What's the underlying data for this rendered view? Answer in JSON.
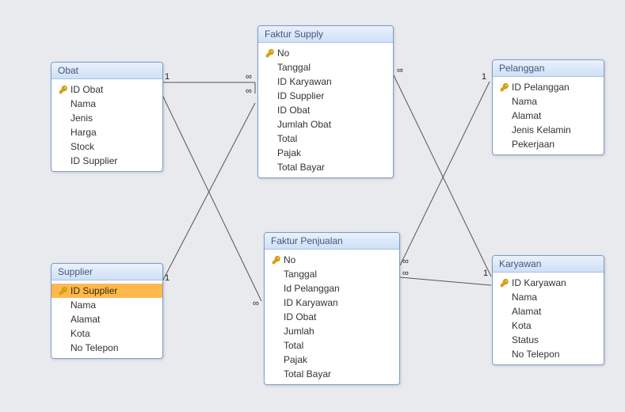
{
  "entities": {
    "obat": {
      "title": "Obat",
      "fields": [
        {
          "label": "ID Obat",
          "pk": true
        },
        {
          "label": "Nama",
          "pk": false
        },
        {
          "label": "Jenis",
          "pk": false
        },
        {
          "label": "Harga",
          "pk": false
        },
        {
          "label": "Stock",
          "pk": false
        },
        {
          "label": "ID Supplier",
          "pk": false
        }
      ]
    },
    "faktur_supply": {
      "title": "Faktur Supply",
      "fields": [
        {
          "label": "No",
          "pk": true
        },
        {
          "label": "Tanggal",
          "pk": false
        },
        {
          "label": "ID Karyawan",
          "pk": false
        },
        {
          "label": "ID Supplier",
          "pk": false
        },
        {
          "label": "ID Obat",
          "pk": false
        },
        {
          "label": "Jumlah Obat",
          "pk": false
        },
        {
          "label": "Total",
          "pk": false
        },
        {
          "label": "Pajak",
          "pk": false
        },
        {
          "label": "Total Bayar",
          "pk": false
        }
      ]
    },
    "pelanggan": {
      "title": "Pelanggan",
      "fields": [
        {
          "label": "ID Pelanggan",
          "pk": true
        },
        {
          "label": "Nama",
          "pk": false
        },
        {
          "label": "Alamat",
          "pk": false
        },
        {
          "label": "Jenis Kelamin",
          "pk": false
        },
        {
          "label": "Pekerjaan",
          "pk": false
        }
      ]
    },
    "supplier": {
      "title": "Supplier",
      "selectedField": "ID Supplier",
      "fields": [
        {
          "label": "ID Supplier",
          "pk": true
        },
        {
          "label": "Nama",
          "pk": false
        },
        {
          "label": "Alamat",
          "pk": false
        },
        {
          "label": "Kota",
          "pk": false
        },
        {
          "label": "No Telepon",
          "pk": false
        }
      ]
    },
    "faktur_penjualan": {
      "title": "Faktur Penjualan",
      "fields": [
        {
          "label": "No",
          "pk": true
        },
        {
          "label": "Tanggal",
          "pk": false
        },
        {
          "label": "Id Pelanggan",
          "pk": false
        },
        {
          "label": "ID Karyawan",
          "pk": false
        },
        {
          "label": "ID Obat",
          "pk": false
        },
        {
          "label": "Jumlah",
          "pk": false
        },
        {
          "label": "Total",
          "pk": false
        },
        {
          "label": "Pajak",
          "pk": false
        },
        {
          "label": "Total Bayar",
          "pk": false
        }
      ]
    },
    "karyawan": {
      "title": "Karyawan",
      "fields": [
        {
          "label": "ID Karyawan",
          "pk": true
        },
        {
          "label": "Nama",
          "pk": false
        },
        {
          "label": "Alamat",
          "pk": false
        },
        {
          "label": "Kota",
          "pk": false
        },
        {
          "label": "Status",
          "pk": false
        },
        {
          "label": "No Telepon",
          "pk": false
        }
      ]
    }
  },
  "symbols": {
    "one": "1",
    "many": "∞"
  },
  "relationships": [
    {
      "from": "obat",
      "to": "faktur_supply",
      "type": "one-to-many"
    },
    {
      "from": "obat",
      "to": "faktur_penjualan",
      "type": "one-to-many"
    },
    {
      "from": "supplier",
      "to": "faktur_supply",
      "type": "one-to-many"
    },
    {
      "from": "pelanggan",
      "to": "faktur_penjualan",
      "type": "one-to-many"
    },
    {
      "from": "karyawan",
      "to": "faktur_supply",
      "type": "one-to-many"
    },
    {
      "from": "karyawan",
      "to": "faktur_penjualan",
      "type": "one-to-many"
    }
  ]
}
